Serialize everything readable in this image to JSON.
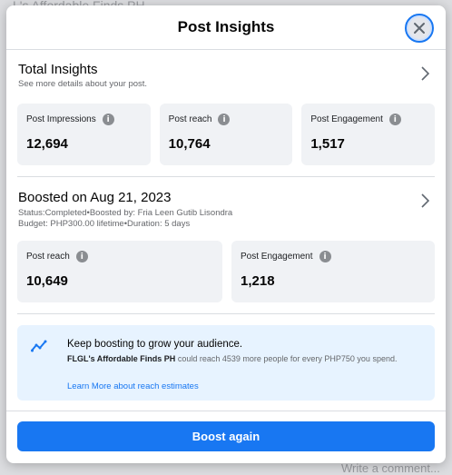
{
  "background": {
    "top_text": "L's Affordable Finds PH",
    "bottom_text": "Write a comment..."
  },
  "modal": {
    "title": "Post Insights",
    "close_icon": "close-icon"
  },
  "total_insights": {
    "title": "Total Insights",
    "subtitle": "See more details about your post.",
    "metrics": [
      {
        "label": "Post Impressions",
        "value": "12,694"
      },
      {
        "label": "Post reach",
        "value": "10,764"
      },
      {
        "label": "Post Engagement",
        "value": "1,517"
      }
    ]
  },
  "boost": {
    "title": "Boosted on Aug 21, 2023",
    "status_line": "Status:Completed•Boosted by: Fria Leen Gutib Lisondra",
    "budget_line": "Budget: PHP300.00 lifetime•Duration: 5 days",
    "metrics": [
      {
        "label": "Post reach",
        "value": "10,649"
      },
      {
        "label": "Post Engagement",
        "value": "1,218"
      }
    ]
  },
  "tip": {
    "icon": "trend-up-icon",
    "title": "Keep boosting to grow your audience.",
    "page_name": "FLGL's Affordable Finds PH",
    "body": " could reach 4539 more people for every PHP750 you spend.",
    "link": "Learn More about reach estimates"
  },
  "footer": {
    "button_label": "Boost again"
  },
  "colors": {
    "accent": "#1877f2",
    "card_bg": "#f0f2f5",
    "tip_bg": "#e7f3ff"
  }
}
